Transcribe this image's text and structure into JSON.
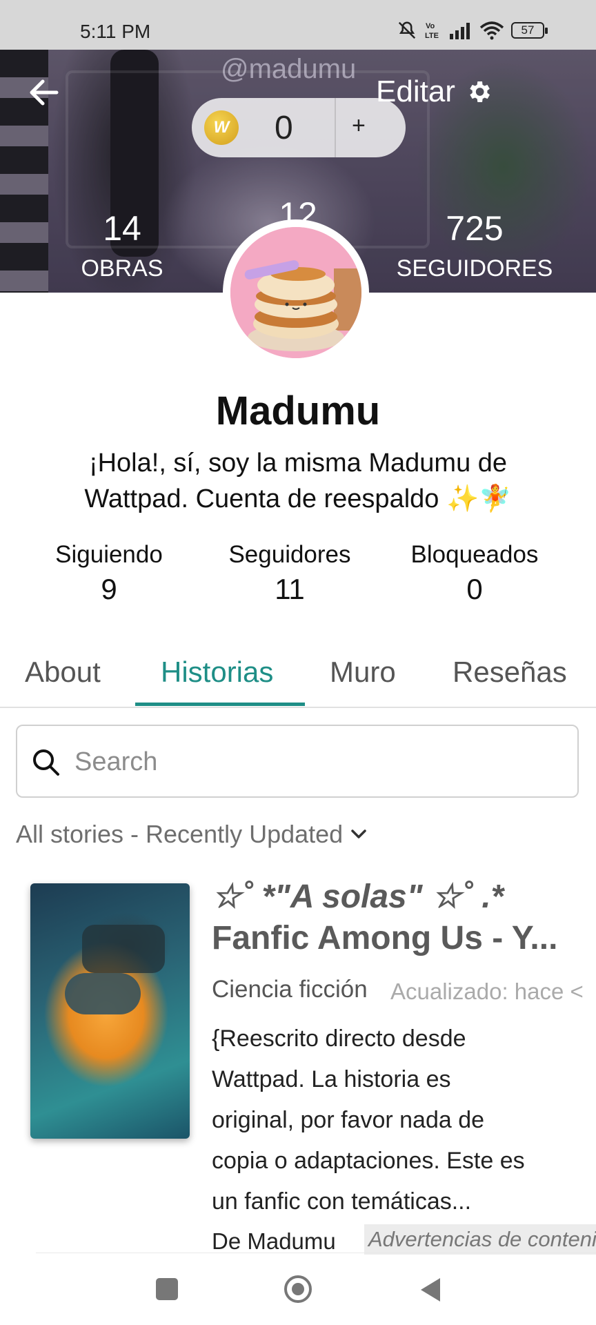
{
  "status_bar": {
    "time": "5:11 PM",
    "battery": "57"
  },
  "header": {
    "handle": "@madumu",
    "edit_label": "Editar",
    "coins": "0",
    "add_label": "+",
    "coin_symbol": "W",
    "stats": [
      {
        "value": "14",
        "label": "OBRAS"
      },
      {
        "value": "12",
        "label": ""
      },
      {
        "value": "725",
        "label": "SEGUIDORES"
      }
    ]
  },
  "profile": {
    "name": "Madumu",
    "bio_line1": "¡Hola!, sí, soy la misma Madumu de",
    "bio_line2": "Wattpad. Cuenta de reespaldo ✨🧚"
  },
  "follow_stats": [
    {
      "label": "Siguiendo",
      "value": "9"
    },
    {
      "label": "Seguidores",
      "value": "11"
    },
    {
      "label": "Bloqueados",
      "value": "0"
    }
  ],
  "tabs": [
    {
      "label": "About"
    },
    {
      "label": "Historias",
      "active": true
    },
    {
      "label": "Muro"
    },
    {
      "label": "Reseñas"
    }
  ],
  "search": {
    "placeholder": "Search"
  },
  "filter": {
    "label": "All stories - Recently Updated"
  },
  "story": {
    "title_line1": "☆˚ *\"A solas\" ☆˚ .*",
    "title_line2": "Fanfic Among Us - Y...",
    "genre": "Ciencia ficción",
    "updated": "Acualizado: hace <",
    "description": "{Reescrito directo desde Wattpad. La historia es original, por favor nada de copia o adaptaciones. Este es un fanfic con temáticas...",
    "author": "De Madumu",
    "warning": "Advertencias de contenido"
  },
  "colors": {
    "accent": "#1e8e86",
    "coin": "#e4b333"
  }
}
